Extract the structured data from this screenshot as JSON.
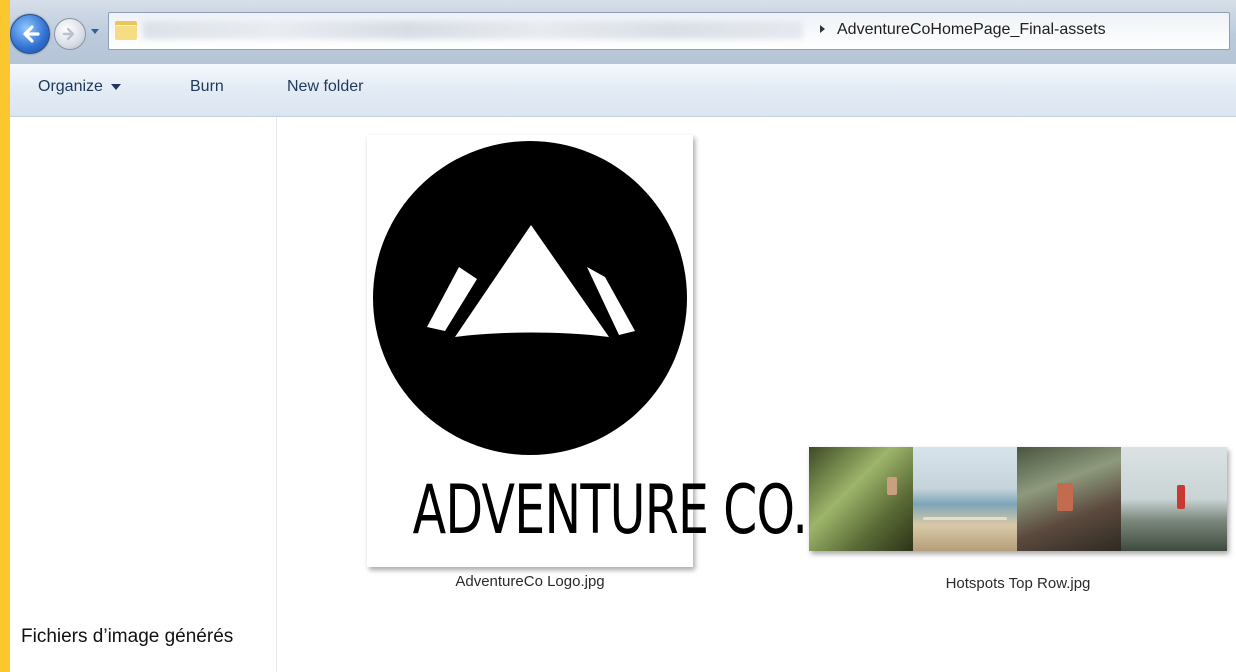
{
  "address_bar": {
    "current_folder": "AdventureCoHomePage_Final-assets"
  },
  "toolbar": {
    "organize_label": "Organize",
    "burn_label": "Burn",
    "new_folder_label": "New folder"
  },
  "files": [
    {
      "name": "AdventureCo Logo.jpg",
      "thumbnail_text": "ADVENTURE CO."
    },
    {
      "name": "Hotspots Top Row.jpg"
    }
  ],
  "caption_overlay": "Fichiers d’image générés",
  "colors": {
    "frame_accent": "#fbc72f",
    "toolbar_text": "#1e395b"
  },
  "icons": [
    "back-arrow-icon",
    "forward-arrow-icon",
    "dropdown-icon",
    "folder-icon",
    "breadcrumb-arrow-icon",
    "chevron-down-icon"
  ]
}
